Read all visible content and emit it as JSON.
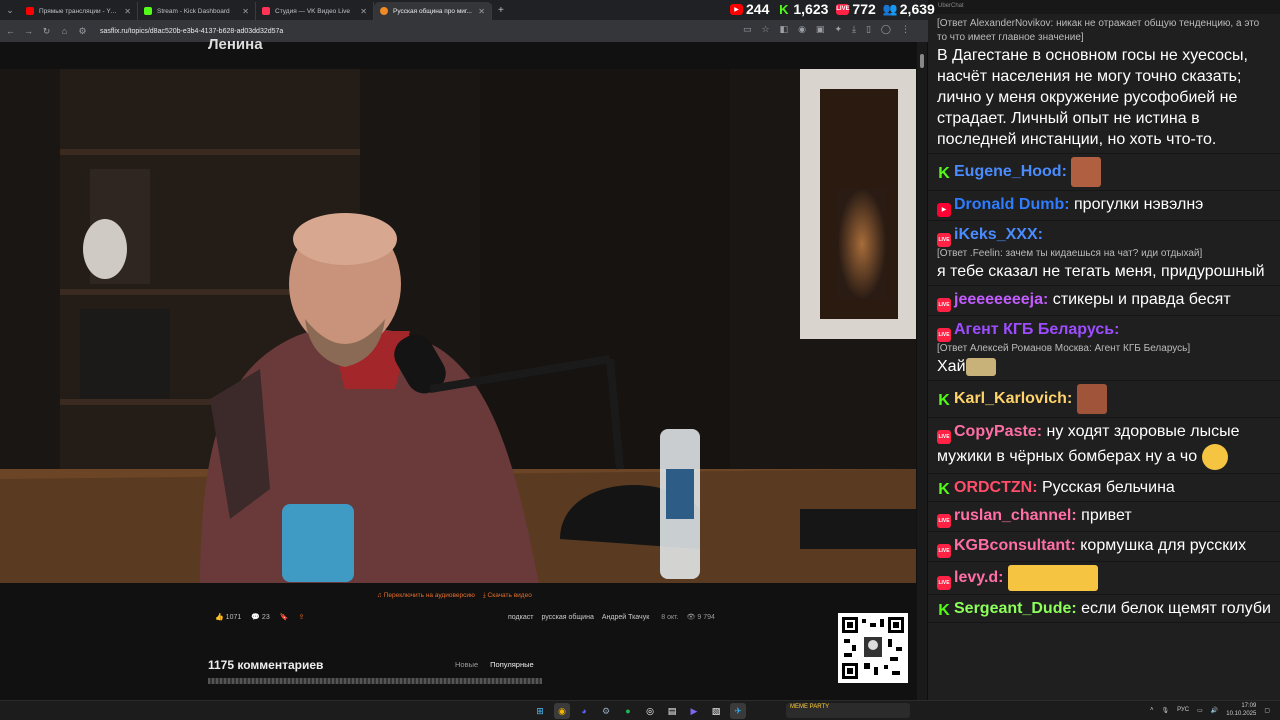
{
  "browser": {
    "tabs": [
      {
        "title": "Прямые трансляции - YouTube",
        "color": "#ff0000"
      },
      {
        "title": "Stream - Kick Dashboard",
        "color": "#53fc18"
      },
      {
        "title": "Студия — VK Видео Live",
        "color": "#ff3355"
      },
      {
        "title": "Русская община про миг...",
        "color": "#f08a24"
      }
    ],
    "url": "sasflix.ru/topics/d8ac520b-e3b4-4137-b628-ad03dd32d57a",
    "new_tab": "+"
  },
  "stats": [
    {
      "value": "244",
      "color": "#ff0000",
      "icon": "youtube-icon"
    },
    {
      "value": "1,623",
      "color": "#53fc18",
      "icon": "kick-icon"
    },
    {
      "value": "772",
      "color": "#ff2244",
      "icon": "vk-live-icon"
    },
    {
      "value": "2,639",
      "color": "#4aa3ff",
      "icon": "total-viewers-icon"
    }
  ],
  "page": {
    "title": "Ленина",
    "video_links": {
      "audio": "Переключить на аудиоверсию",
      "download": "Скачать видео"
    },
    "likes": "1071",
    "comments_count": "23",
    "tags": [
      "подкаст",
      "русская община",
      "Андрей Ткачук"
    ],
    "date": "8 окт.",
    "views": "9 794",
    "comments_title": "1175 комментариев",
    "sort": [
      "Новые",
      "Популярные"
    ]
  },
  "chat": {
    "header": "UberChat",
    "messages": [
      {
        "platform": "reply-only",
        "reply": "[Ответ AlexanderNovikov: никак не отражает общую тенденцию, а это то что имеет главное значение]",
        "text": "В Дагестане в основном госы не хуесосы, насчёт населения не могу точно сказать; лично у меня окружение русофобией не страдает. Личный опыт не истина в последней инстанции, но хоть что-то."
      },
      {
        "platform": "kick",
        "user": "Eugene_Hood:",
        "color": "#4a8cff",
        "text": "",
        "emote": "#b06040"
      },
      {
        "platform": "yt",
        "user": "Dronald Dumb:",
        "color": "#2f7cff",
        "text": "прогулки нэвэлнэ"
      },
      {
        "platform": "live",
        "user": "iKeks_XXX:",
        "color": "#4a8cff",
        "reply": "[Ответ .Feelin: зачем ты кидаешься на чат? иди отдыхай]",
        "text": "я тебе сказал не тегать меня, придурошный"
      },
      {
        "platform": "live",
        "user": "jeeeeeeeeja:",
        "color": "#c35cff",
        "text": "стикеры и правда бесят"
      },
      {
        "platform": "live",
        "user": "Агент КГБ Беларусь:",
        "color": "#9d4dff",
        "reply": "[Ответ Алексей Романов Москва: Агент КГБ Беларусь]",
        "text": "Хай"
      },
      {
        "platform": "kick",
        "user": "Karl_Karlovich:",
        "color": "#ffd36b",
        "text": "",
        "emote": "#a0553a"
      },
      {
        "platform": "live",
        "user": "CopyPaste:",
        "color": "#ff6fa5",
        "text": "ну ходят здоровые лысые мужики в чёрных бомберах ну а чо"
      },
      {
        "platform": "kick",
        "user": "ORDCTZN:",
        "color": "#ff4d6a",
        "text": "Русская бельчина"
      },
      {
        "platform": "live",
        "user": "ruslan_channel:",
        "color": "#ff6fa5",
        "text": "привет"
      },
      {
        "platform": "live",
        "user": "KGBconsultant:",
        "color": "#ff6fa5",
        "text": "кормушка для русских"
      },
      {
        "platform": "live",
        "user": "levy.d:",
        "color": "#ff6fa5",
        "text": "",
        "emote": "#f5c542"
      },
      {
        "platform": "kick",
        "user": "Sergeant_Dude:",
        "color": "#8cff5a",
        "text": "если белок щемят голуби"
      }
    ]
  },
  "taskbar": {
    "meme_party": "MEME PARTY",
    "lang": "РУС",
    "time": "17:09",
    "date": "10.10.2025"
  }
}
